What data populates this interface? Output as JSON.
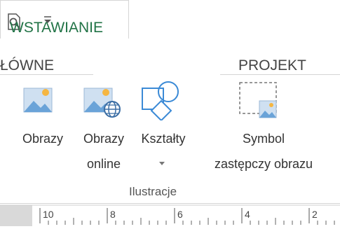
{
  "qat": {
    "preview_icon": "print-preview-icon",
    "customize_icon": "customize-qat-icon"
  },
  "tabs": {
    "home": "ŁÓWNE",
    "insert": "WSTAWIANIE",
    "design": "PROJEKT"
  },
  "ribbon": {
    "pictures": {
      "label": "Obrazy",
      "icon": "picture-icon"
    },
    "online_pictures": {
      "label1": "Obrazy",
      "label2": "online",
      "icon": "online-picture-icon"
    },
    "shapes": {
      "label": "Kształty",
      "icon": "shapes-icon"
    },
    "placeholder": {
      "label1": "Symbol",
      "label2": "zastępczy obrazu",
      "icon": "picture-placeholder-icon"
    },
    "group_label": "Ilustracje"
  },
  "ruler": {
    "ticks": [
      "10",
      "8",
      "6",
      "4",
      "2"
    ]
  },
  "colors": {
    "accent": "#217346",
    "icon_blue": "#5a9bd5",
    "icon_sun": "#f5b642"
  }
}
